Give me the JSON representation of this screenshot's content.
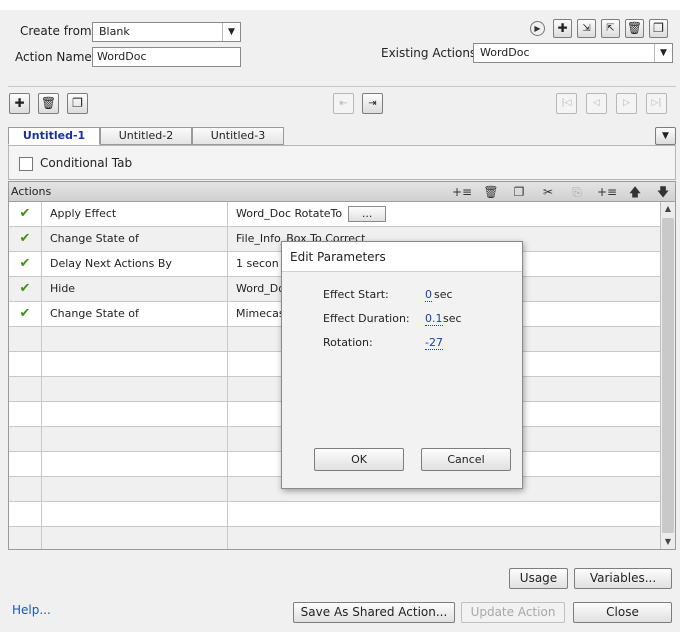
{
  "top": {
    "create_from_label": "Create from:",
    "create_from_value": "Blank",
    "action_name_label": "Action Name:",
    "action_name_value": "WordDoc",
    "existing_label": "Existing Actions:",
    "existing_value": "WordDoc"
  },
  "tabs": [
    "Untitled-1",
    "Untitled-2",
    "Untitled-3"
  ],
  "conditional_label": "Conditional Tab",
  "grid": {
    "header": "Actions",
    "rows": [
      {
        "check": "✔",
        "action": "Apply Effect",
        "target": "Word_Doc   RotateTo",
        "has_button": true,
        "button_label": "..."
      },
      {
        "check": "✔",
        "action": "Change State of",
        "target": "File_Info_Box   To   Correct"
      },
      {
        "check": "✔",
        "action": "Delay Next Actions By",
        "target": "1   secon"
      },
      {
        "check": "✔",
        "action": "Hide",
        "target": "Word_Do"
      },
      {
        "check": "✔",
        "action": "Change State of",
        "target": "Mimecast"
      }
    ]
  },
  "dialog": {
    "title": "Edit Parameters",
    "effect_start_label": "Effect Start:",
    "effect_start_value": "0",
    "effect_start_unit": "sec",
    "effect_duration_label": "Effect Duration:",
    "effect_duration_value": "0.1",
    "effect_duration_unit": "sec",
    "rotation_label": "Rotation:",
    "rotation_value": "-27",
    "ok_label": "OK",
    "cancel_label": "Cancel"
  },
  "bottom": {
    "usage_label": "Usage",
    "variables_label": "Variables...",
    "help_label": "Help...",
    "save_shared_label": "Save As Shared Action...",
    "update_label": "Update Action",
    "close_label": "Close"
  },
  "colors": {
    "check": "#3f8f16",
    "active_tab": "#1a2fa0",
    "link": "#1a56b0"
  }
}
